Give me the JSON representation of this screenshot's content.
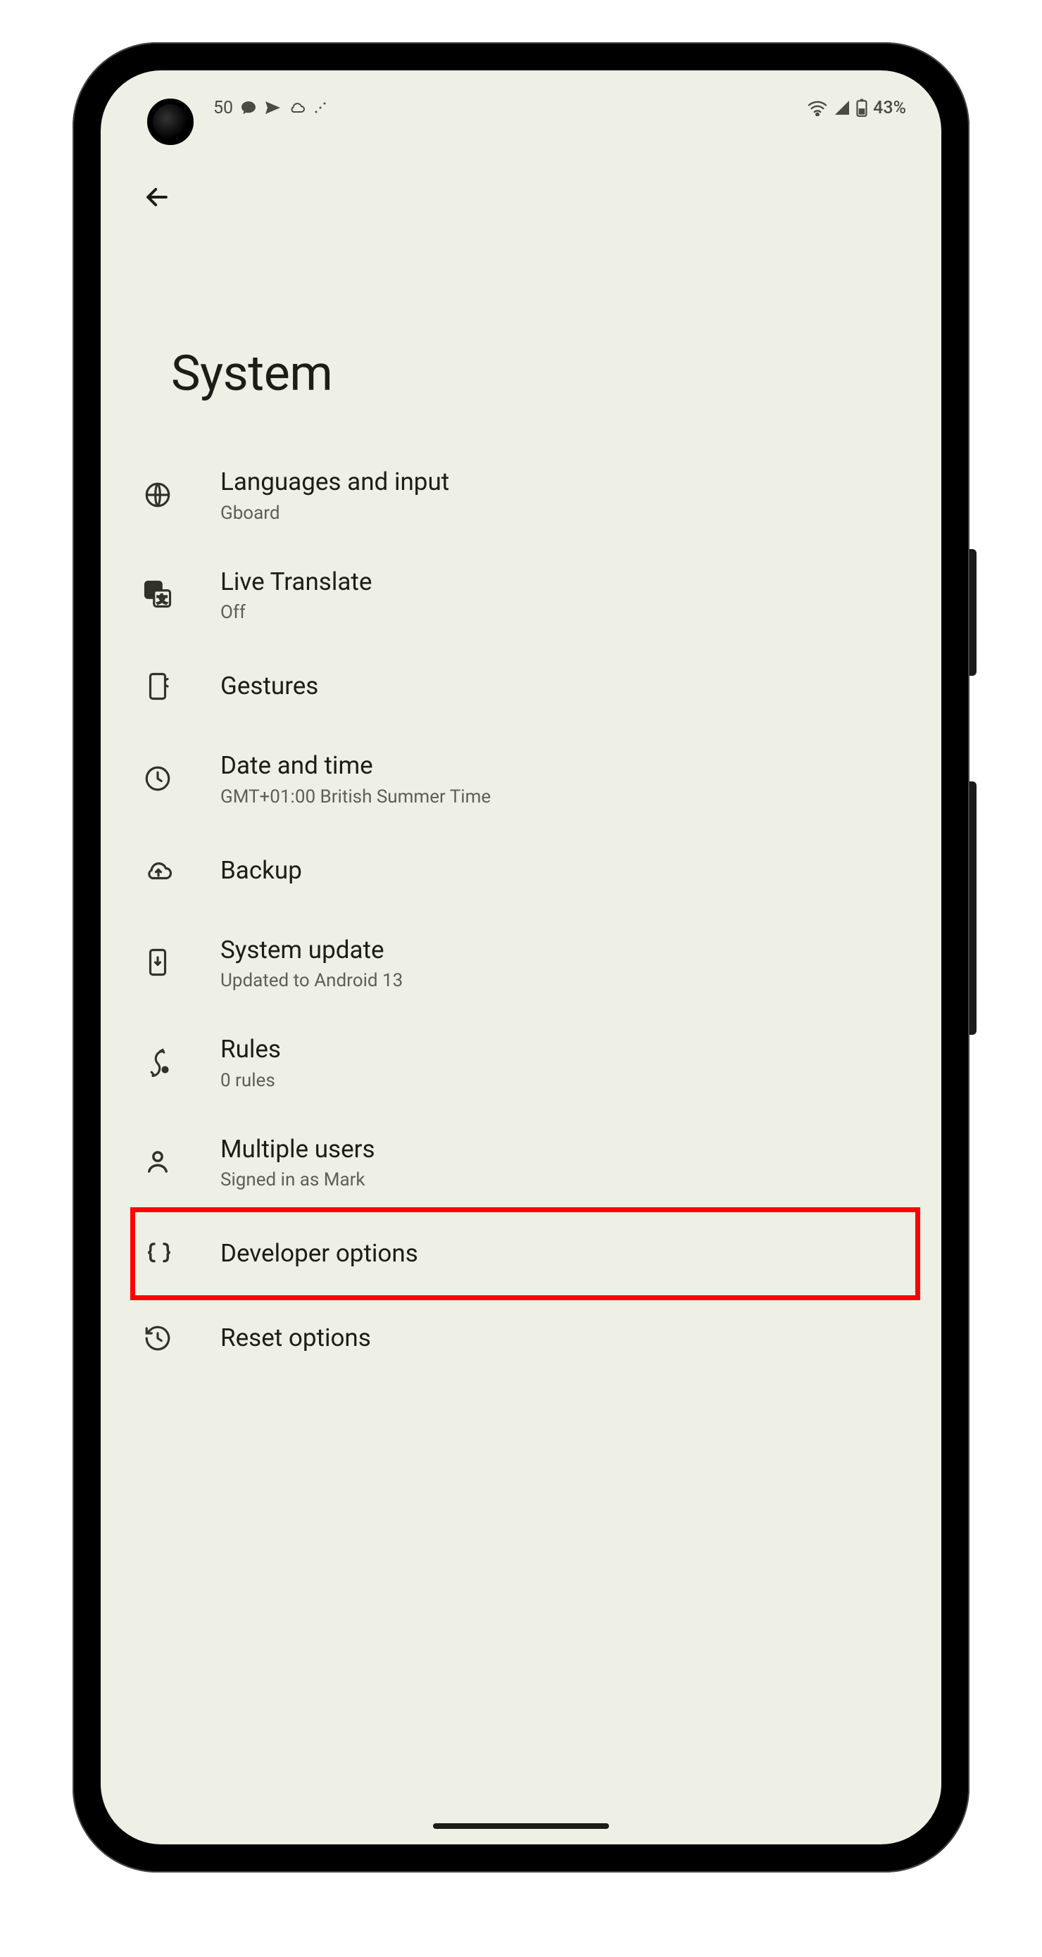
{
  "status": {
    "time_fragment": "50",
    "battery_text": "43%"
  },
  "page": {
    "title": "System"
  },
  "rows": [
    {
      "id": "languages",
      "title": "Languages and input",
      "subtitle": "Gboard",
      "icon": "globe",
      "highlight": false
    },
    {
      "id": "live-translate",
      "title": "Live Translate",
      "subtitle": "Off",
      "icon": "translate",
      "highlight": false
    },
    {
      "id": "gestures",
      "title": "Gestures",
      "subtitle": "",
      "icon": "gesture-phone",
      "highlight": false
    },
    {
      "id": "date-time",
      "title": "Date and time",
      "subtitle": "GMT+01:00 British Summer Time",
      "icon": "clock",
      "highlight": false
    },
    {
      "id": "backup",
      "title": "Backup",
      "subtitle": "",
      "icon": "cloud-up",
      "highlight": false
    },
    {
      "id": "system-update",
      "title": "System update",
      "subtitle": "Updated to Android 13",
      "icon": "phone-download",
      "highlight": false
    },
    {
      "id": "rules",
      "title": "Rules",
      "subtitle": "0 rules",
      "icon": "rules",
      "highlight": false
    },
    {
      "id": "multiple-users",
      "title": "Multiple users",
      "subtitle": "Signed in as Mark",
      "icon": "person",
      "highlight": false
    },
    {
      "id": "developer-options",
      "title": "Developer options",
      "subtitle": "",
      "icon": "braces",
      "highlight": true
    },
    {
      "id": "reset-options",
      "title": "Reset options",
      "subtitle": "",
      "icon": "history",
      "highlight": false
    }
  ]
}
